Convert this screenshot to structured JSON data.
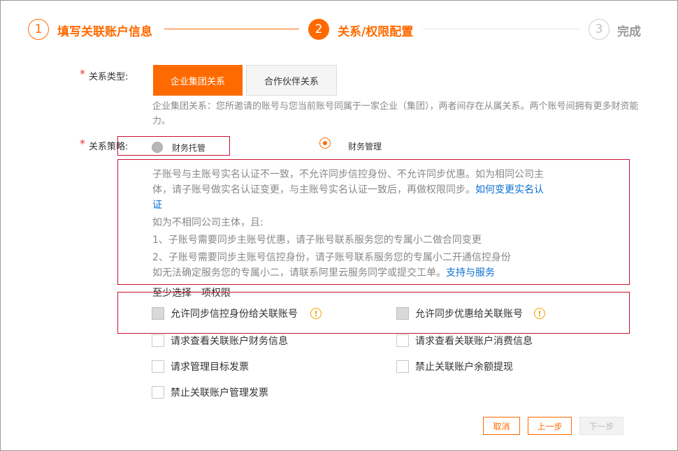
{
  "steps": [
    {
      "number": "1",
      "label": "填写关联账户信息"
    },
    {
      "number": "2",
      "label": "关系/权限配置"
    },
    {
      "number": "3",
      "label": "完成"
    }
  ],
  "relation_type": {
    "label": "关系类型:",
    "options": [
      "企业集团关系",
      "合作伙伴关系"
    ],
    "selected": "企业集团关系",
    "hint": "企业集团关系：您所邀请的账号与您当前账号同属于一家企业（集团），两者间存在从属关系。两个账号间拥有更多财资能力。"
  },
  "relation_strategy": {
    "label": "关系策略:",
    "options": [
      "财务托管",
      "财务管理"
    ],
    "selected": "财务管理"
  },
  "info": {
    "line1": "子账号与主账号实名认证不一致，不允许同步信控身份、不允许同步优惠。如为相同公司主",
    "line2": "体，请子账号做实名认证变更，与主账号实名认证一致后，再做权限同步。",
    "link1_a": "如何变更实名认",
    "link1_b": "证",
    "line4": "如为不相同公司主体，且:",
    "line5": "1、子账号需要同步主账号优惠，请子账号联系服务您的专属小二做合同变更",
    "line6": "2、子账号需要同步主账号信控身份，请子账号联系服务您的专属小二开通信控身份",
    "line7": "如无法确定服务您的专属小二，请联系阿里云服务同学或提交工单。",
    "link2": "支持与服务"
  },
  "permissions": {
    "title": "至少选择一项权限",
    "items": [
      "允许同步信控身份给关联账号",
      "允许同步优惠给关联账号",
      "请求查看关联账户财务信息",
      "请求查看关联账户消费信息",
      "请求管理目标发票",
      "禁止关联账户余额提现",
      "禁止关联账户管理发票"
    ]
  },
  "footer": {
    "cancel": "取消",
    "prev": "上一步",
    "next": "下一步"
  },
  "colors": {
    "accent": "#ff6a00",
    "link": "#0a6fd1",
    "annotation_red": "#c8102e",
    "warn": "#f0a000"
  }
}
